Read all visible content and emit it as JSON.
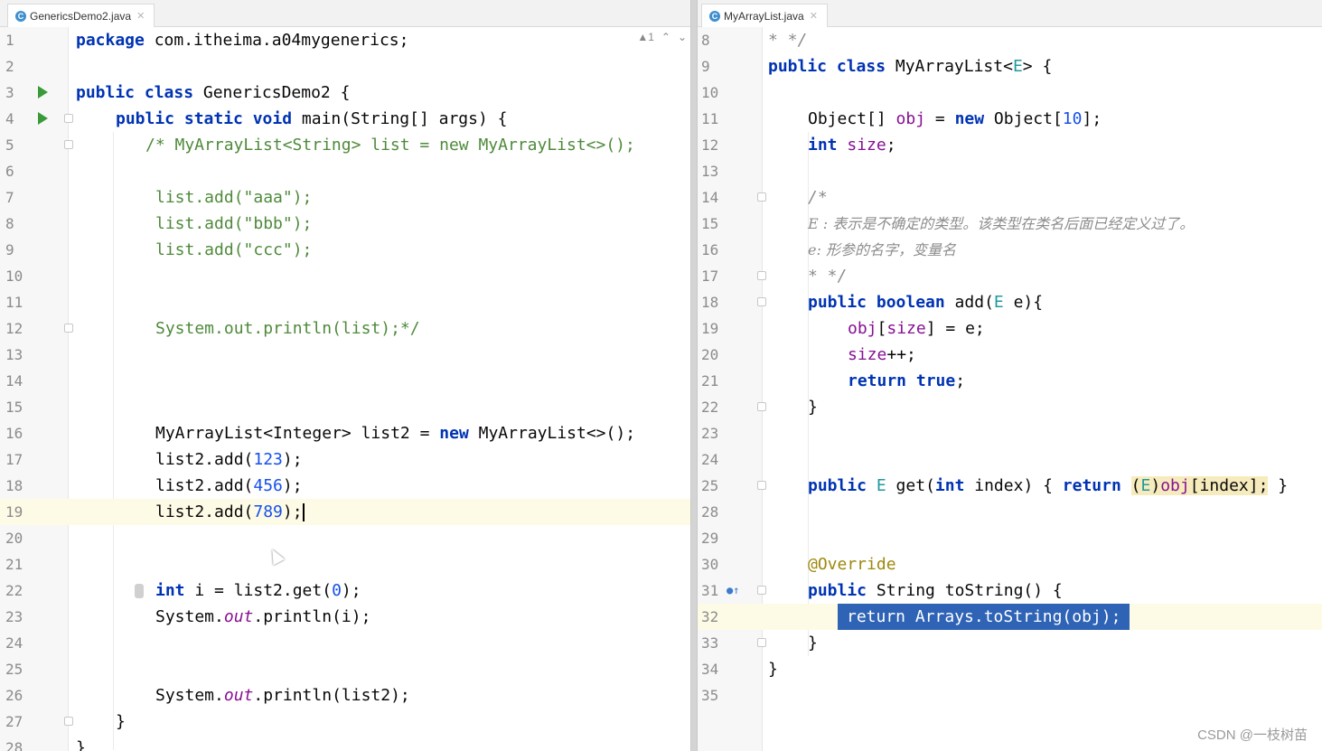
{
  "left_editor": {
    "tab_label": "GenericsDemo2.java",
    "warnings_label": "▲1",
    "lines": [
      {
        "n": "1"
      },
      {
        "n": "2"
      },
      {
        "n": "3"
      },
      {
        "n": "4"
      },
      {
        "n": "5"
      },
      {
        "n": "6"
      },
      {
        "n": "7"
      },
      {
        "n": "8"
      },
      {
        "n": "9"
      },
      {
        "n": "10"
      },
      {
        "n": "11"
      },
      {
        "n": "12"
      },
      {
        "n": "13"
      },
      {
        "n": "14"
      },
      {
        "n": "15"
      },
      {
        "n": "16"
      },
      {
        "n": "17"
      },
      {
        "n": "18"
      },
      {
        "n": "19"
      },
      {
        "n": "20"
      },
      {
        "n": "21"
      },
      {
        "n": "22"
      },
      {
        "n": "23"
      },
      {
        "n": "24"
      },
      {
        "n": "25"
      },
      {
        "n": "26"
      },
      {
        "n": "27"
      },
      {
        "n": "28"
      }
    ],
    "code": {
      "l1_kw": "package",
      "l1_rest": " com.itheima.a04mygenerics;",
      "l3_kw": "public class",
      "l3_rest": " GenericsDemo2 {",
      "l4_kw": "public static void",
      "l4_rest": " main(String[] args) {",
      "l5": "/* MyArrayList<String> list = new MyArrayList<>();",
      "l7": "list.add(\"aaa\");",
      "l8": "list.add(\"bbb\");",
      "l9": "list.add(\"ccc\");",
      "l12": "System.out.println(list);*/",
      "l16_a": "MyArrayList<Integer> list2 = ",
      "l16_kw": "new",
      "l16_b": " MyArrayList<>();",
      "l17_a": "list2.add(",
      "l17_n": "123",
      "l17_b": ");",
      "l18_a": "list2.add(",
      "l18_n": "456",
      "l18_b": ");",
      "l19_a": "list2.add(",
      "l19_n": "789",
      "l19_b": ");",
      "l22_kw": "int",
      "l22_a": " i = list2.get(",
      "l22_n": "0",
      "l22_b": ");",
      "l23_a": "System.",
      "l23_i": "out",
      "l23_b": ".println(i);",
      "l26_a": "System.",
      "l26_i": "out",
      "l26_b": ".println(list2);",
      "l27": "}",
      "l28": "}"
    }
  },
  "right_editor": {
    "tab_label": "MyArrayList.java",
    "lines": [
      {
        "n": "8"
      },
      {
        "n": "9"
      },
      {
        "n": "10"
      },
      {
        "n": "11"
      },
      {
        "n": "12"
      },
      {
        "n": "13"
      },
      {
        "n": "14"
      },
      {
        "n": "15"
      },
      {
        "n": "16"
      },
      {
        "n": "17"
      },
      {
        "n": "18"
      },
      {
        "n": "19"
      },
      {
        "n": "20"
      },
      {
        "n": "21"
      },
      {
        "n": "22"
      },
      {
        "n": "23"
      },
      {
        "n": "24"
      },
      {
        "n": "25"
      },
      {
        "n": "28"
      },
      {
        "n": "29"
      },
      {
        "n": "30"
      },
      {
        "n": "31"
      },
      {
        "n": "32"
      },
      {
        "n": "33"
      },
      {
        "n": "34"
      },
      {
        "n": "35"
      }
    ],
    "code": {
      "l8": "* */",
      "l9_kw": "public class",
      "l9_a": " MyArrayList<",
      "l9_t": "E",
      "l9_b": "> {",
      "l11_a": "Object[] ",
      "l11_f": "obj",
      "l11_b": " = ",
      "l11_kw": "new",
      "l11_c": " Object[",
      "l11_n": "10",
      "l11_d": "];",
      "l12_kw": "int",
      "l12_f": " size",
      "l12_b": ";",
      "l14": "/*",
      "l15": "E : 表示是不确定的类型。该类型在类名后面已经定义过了。",
      "l16": "e: 形参的名字，变量名",
      "l17": "* */",
      "l18_kw": "public boolean",
      "l18_a": " add(",
      "l18_t": "E",
      "l18_b": " e){",
      "l19_f1": "obj",
      "l19_a": "[",
      "l19_f2": "size",
      "l19_b": "] = e;",
      "l20_f": "size",
      "l20_b": "++;",
      "l21_kw": "return true",
      "l21_b": ";",
      "l22": "}",
      "l25_kw": "public",
      "l25_t": " E",
      "l25_a": " get(",
      "l25_kw2": "int",
      "l25_b": " index) { ",
      "l25_kw3": "return",
      "l25_sp": " ",
      "l25_c": "(",
      "l25_t2": "E",
      "l25_d": ")",
      "l25_f": "obj",
      "l25_e": "[index];",
      "l25_end": " }",
      "l30": "@Override",
      "l31_kw": "public",
      "l31_a": " String toString() {",
      "l32": "return Arrays.toString(obj);",
      "l33": "}",
      "l34": "}"
    }
  },
  "watermark": "CSDN @一枝树苗"
}
